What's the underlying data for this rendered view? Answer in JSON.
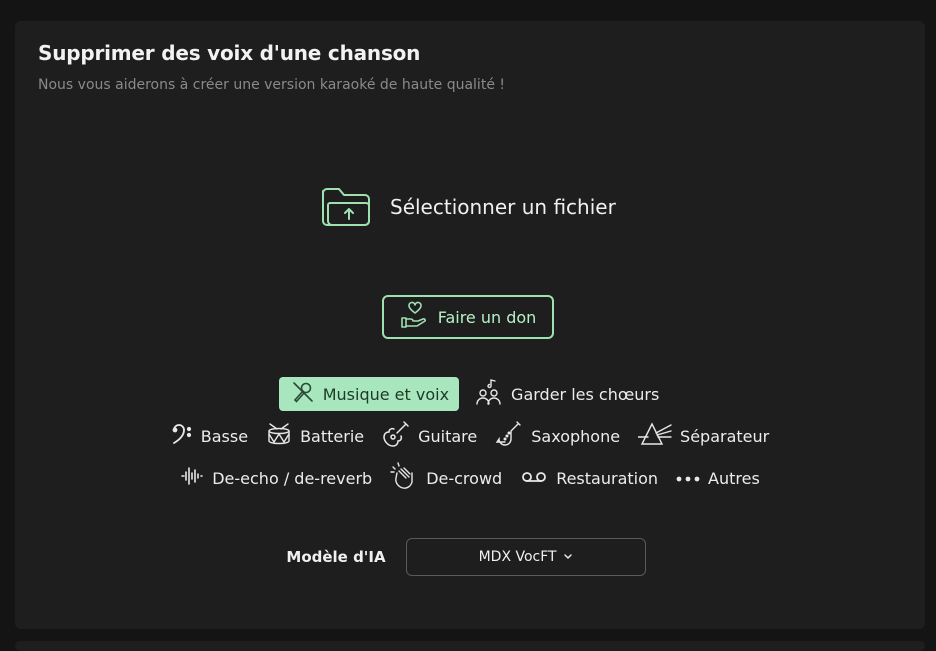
{
  "header": {
    "title": "Supprimer des voix d'une chanson",
    "subtitle": "Nous vous aiderons à créer une version karaoké de haute qualité !"
  },
  "upload": {
    "label": "Sélectionner un fichier",
    "icon": "folder-upload-icon"
  },
  "donate": {
    "label": "Faire un don",
    "icon": "hand-heart-icon"
  },
  "options": {
    "row1": [
      {
        "label": "Musique et voix",
        "icon": "microphone-slash-icon",
        "active": true
      },
      {
        "label": "Garder les chœurs",
        "icon": "choir-icon",
        "active": false
      }
    ],
    "row2": [
      {
        "label": "Basse",
        "icon": "bass-clef-icon"
      },
      {
        "label": "Batterie",
        "icon": "drum-icon"
      },
      {
        "label": "Guitare",
        "icon": "guitar-icon"
      },
      {
        "label": "Saxophone",
        "icon": "saxophone-icon"
      },
      {
        "label": "Séparateur",
        "icon": "prism-icon"
      }
    ],
    "row3": [
      {
        "label": "De-echo / de-reverb",
        "icon": "waveform-icon"
      },
      {
        "label": "De-crowd",
        "icon": "clapping-hands-icon"
      },
      {
        "label": "Restauration",
        "icon": "voicemail-icon"
      },
      {
        "label": "Autres",
        "icon": "more-dots-icon"
      }
    ]
  },
  "model": {
    "label": "Modèle d'IA",
    "value": "MDX VocFT"
  },
  "colors": {
    "accent": "#a8e6bd",
    "panel": "#1e1e1e",
    "background": "#141414"
  }
}
